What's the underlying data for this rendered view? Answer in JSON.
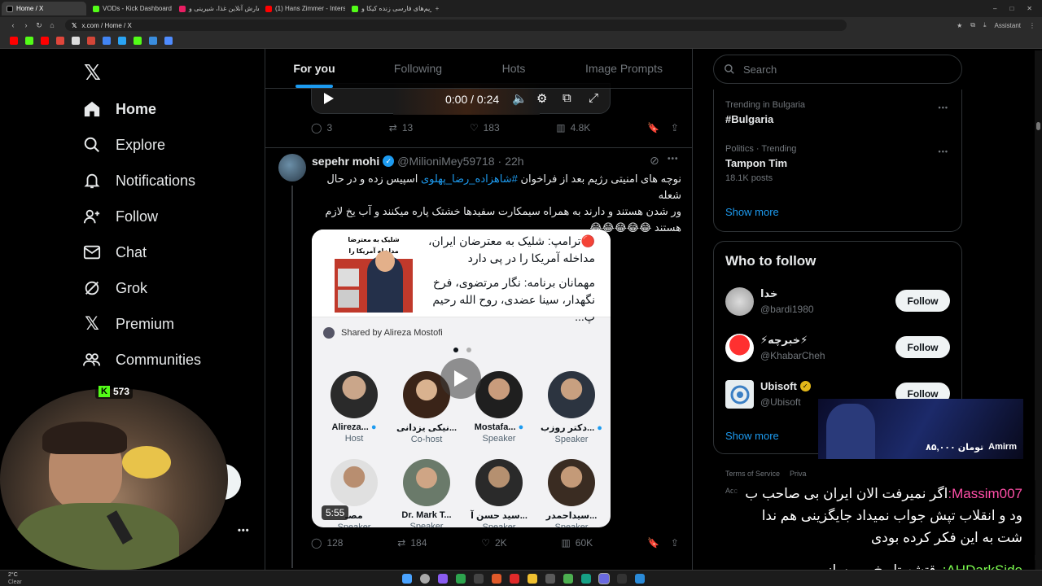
{
  "browser": {
    "tabs": [
      {
        "label": "Home / X",
        "active": true,
        "color": "#000000"
      },
      {
        "label": "VODs - Kick Dashboard",
        "active": false,
        "color": "#53fc18"
      },
      {
        "label": "سفارش آنلاین غذا، شیرینی و...",
        "active": false,
        "color": "#e91e63"
      },
      {
        "label": "(1) Hans Zimmer - Interstellar",
        "active": false,
        "color": "#ff0000"
      },
      {
        "label": "استریم‌های فارسی زنده کیکا و...",
        "active": false,
        "color": "#53fc18"
      }
    ],
    "url": "x.com / Home / X",
    "assistant_label": "Assistant"
  },
  "nav": {
    "items": [
      {
        "label": "Home",
        "icon": "home-icon"
      },
      {
        "label": "Explore",
        "icon": "search-icon"
      },
      {
        "label": "Notifications",
        "icon": "bell-icon"
      },
      {
        "label": "Follow",
        "icon": "person-add-icon"
      },
      {
        "label": "Chat",
        "icon": "mail-icon"
      },
      {
        "label": "Grok",
        "icon": "grok-icon"
      },
      {
        "label": "Premium",
        "icon": "x-logo-icon"
      },
      {
        "label": "Communities",
        "icon": "people-icon"
      }
    ],
    "more_dots": "•••"
  },
  "feed": {
    "tabs": [
      "For you",
      "Following",
      "Hots",
      "Image Prompts"
    ],
    "video_player": {
      "time": "0:00 / 0:24"
    },
    "post1_actions": {
      "replies": "3",
      "reposts": "13",
      "likes": "183",
      "views": "4.8K"
    },
    "post2": {
      "name": "sepehr mohi",
      "handle": "@MilioniMey59718",
      "time": "22h",
      "text_line1": "نوچه های امنیتی رژیم بعد از فراخوان ",
      "hashtag": "#شاهزاده_رضا_پهلوی",
      "text_line1_end": " اسپیس زده و در حال شعله",
      "text_line2": "ور شدن هستند و دارند به همراه سیمکارت سفیدها خشتک پاره میکنند و آب یخ لازم",
      "text_line3": "هستند 😂😂😂😂😂",
      "card": {
        "headline1": "🔴ترامپ: شلیک به معترضان ایران،",
        "headline2": "مداخله آمریکا را در پی دارد",
        "guests1": "مهمانان برنامه: نگار مرتضوی، فرخ",
        "guests2": "نگهدار، سینا عضدی، روح الله رحیم پ...",
        "thumb_text1": "شلیک به معترضا",
        "thumb_text2": "مداخله آمریکا را",
        "shared_by": "Shared by Alireza Mostofi",
        "speakers": [
          {
            "name": "Alireza...",
            "role": "Host"
          },
          {
            "name": "نیکی یزدانی...",
            "role": "Co-host"
          },
          {
            "name": "Mostafa...",
            "role": "Speaker"
          },
          {
            "name": "دکتر روزب...",
            "role": "Speaker"
          },
          {
            "name": "مصـ",
            "role": "Speaker"
          },
          {
            "name": "Dr. Mark T...",
            "role": "Speaker"
          },
          {
            "name": "سید حسن آ...",
            "role": "Speaker"
          },
          {
            "name": "سیداحمدر...",
            "role": "Speaker"
          }
        ],
        "duration": "5:55"
      },
      "actions": {
        "replies": "128",
        "reposts": "184",
        "likes": "2K",
        "views": "60K"
      }
    }
  },
  "right": {
    "search_placeholder": "Search",
    "trends": [
      {
        "context": "Trending in Bulgaria",
        "name": "#Bulgaria",
        "posts": ""
      },
      {
        "context": "Politics · Trending",
        "name": "Tampon Tim",
        "posts": "18.1K posts"
      }
    ],
    "show_more": "Show more",
    "who_to_follow_title": "Who to follow",
    "who_to_follow": [
      {
        "name": "خدا",
        "handle": "@bardi1980",
        "button": "Follow"
      },
      {
        "name": "⚡خبرچه⚡",
        "handle": "@KhabarCheh",
        "button": "Follow"
      },
      {
        "name": "Ubisoft",
        "handle": "@Ubisoft",
        "button": "Follow"
      }
    ],
    "show_more_2": "Show more",
    "footer_terms": "Terms of Service",
    "footer_privacy": "Priva",
    "footer_acc": "Acc"
  },
  "stream_overlay": {
    "kick_viewers": "573",
    "donation_user": "Amirm",
    "donation_amount": "۸۵,۰۰۰ تومان",
    "chat": [
      {
        "user": "Massim007",
        "user_color": "#ff4fa8",
        "text": "اگر نمیرفت الان ایران بی صاحب ب",
        "cont": [
          "ود و انقلاب تپش جواب نمیداد جایگزینی هم ندا",
          "شت به این فکر کرده بودی"
        ]
      },
      {
        "user": "AHDarkSide",
        "user_color": "#7dff4f",
        "text": "وقتشه تاریخ رو بسازیم",
        "cont": []
      }
    ]
  },
  "taskbar": {
    "weather_temp": "2°C",
    "weather_label": "Clear"
  },
  "colors": {
    "accent": "#1d9bf0",
    "border": "#2f3336",
    "muted": "#71767b",
    "kick": "#53fc18"
  }
}
